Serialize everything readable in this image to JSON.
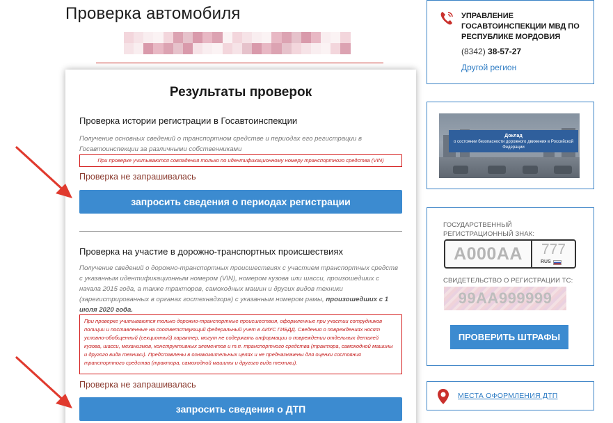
{
  "page": {
    "title": "Проверка автомобиля"
  },
  "results": {
    "title": "Результаты проверок",
    "registration": {
      "title": "Проверка истории регистрации в Госавтоинспекции",
      "description": "Получение основных сведений о транспортном средстве и периодах его регистрации в Госавтоинспекции за различными собственниками",
      "note": "При проверке учитываются совпадения только по идентификационному номеру транспортного средства (VIN)",
      "status": "Проверка не запрашивалась",
      "button_label": "запросить сведения о периодах регистрации"
    },
    "accidents": {
      "title": "Проверка на участие в дорожно-транспортных происшествиях",
      "description": "Получение сведений о дорожно-транспортных происшествиях с участием транспортных средств с указанным идентификационным номером (VIN), номером кузова или шасси, произошедших с начала 2015 года, а также тракторов, самоходных машин и других видов техники (зарегистрированных в органах гостехнадзора) с указанным номером рамы,",
      "description_bold": "произошедших с 1 июля 2020 года.",
      "note": "При проверке учитываются только дорожно-транспортные происшествия, оформленные при участии сотрудников полиции и поставленные на соответствующий федеральный учет в АИУС ГИБДД. Сведения о повреждениях носят условно-обобщенный (секционный) характер, могут не содержать информации о повреждении отдельных деталей кузова, шасси, механизмов, конструктивных элементов и т.п. транспортного средства (трактора, самоходной машины и другого вида техники). Представлены в ознакомительных целях и не предназначены для оценки состояния транспортного средства (трактора, самоходной машины и другого вида техники).",
      "status": "Проверка не запрашивалась",
      "button_label": "запросить сведения о ДТП"
    }
  },
  "sidebar": {
    "contact": {
      "icon": "phone-icon",
      "title": "Управление Госавтоинспекции МВД по Республике Мордовия",
      "phone_code": "(8342)",
      "phone_number": "38-57-27",
      "region_link": "Другой регион"
    },
    "report": {
      "title": "Доклад",
      "subtitle": "о состоянии безопасности дорожного движения в Российской Федерации"
    },
    "fines": {
      "plate_label": "Государственный регистрационный знак:",
      "plate_number": "А000АА",
      "plate_region": "777",
      "plate_country": "RUS",
      "cert_label": "Свидетельство о регистрации ТС:",
      "cert_number": "99АА999999",
      "button_label": "Проверить штрафы"
    },
    "dtp": {
      "icon": "map-pin-icon",
      "link": "Места оформления ДТП"
    }
  },
  "colors": {
    "accent_blue": "#3c8bd0",
    "link_blue": "#2e7cc4",
    "border_blue": "#3b83c6",
    "warning_red": "#d41c1c",
    "arrow_red": "#e03a2e"
  }
}
